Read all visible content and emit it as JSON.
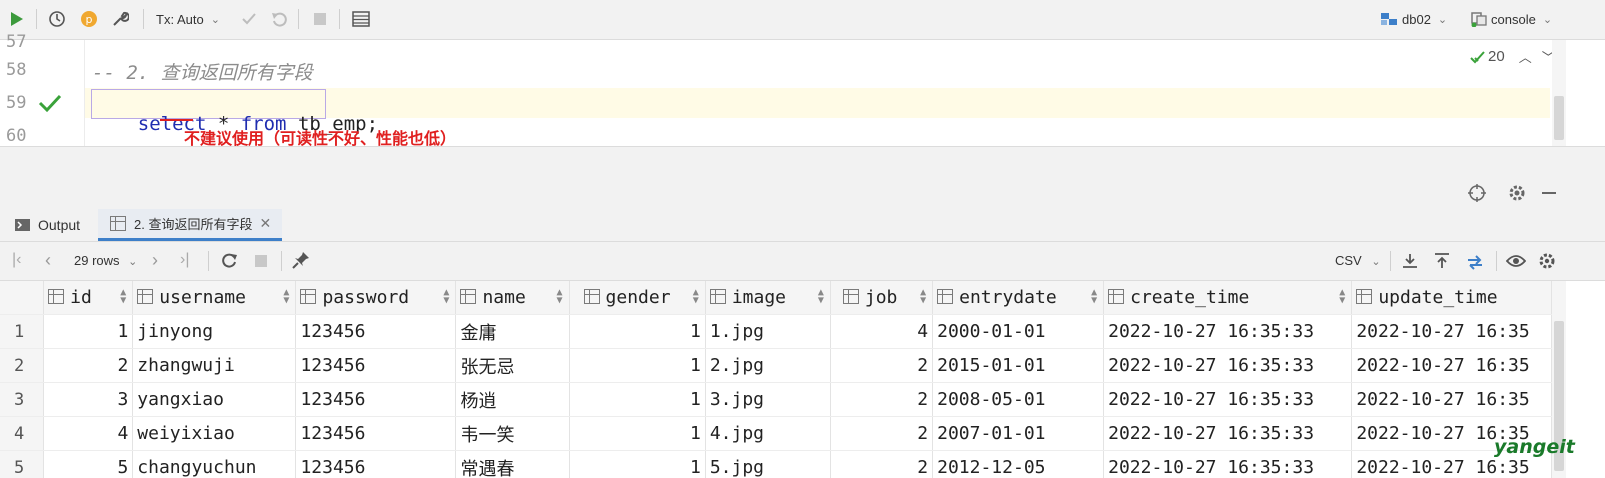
{
  "toolbar": {
    "tx_mode": "Tx: Auto",
    "datasource": "db02",
    "session": "console"
  },
  "editor": {
    "lines": [
      {
        "num": "57",
        "text": ""
      },
      {
        "num": "58",
        "text": "-- 2. 查询返回所有字段"
      },
      {
        "num": "59",
        "text": "select * from tb_emp;"
      },
      {
        "num": "60",
        "text": ""
      }
    ],
    "code_tokens": {
      "kw_select": "select",
      "star": " * ",
      "kw_from": "from",
      "rest": " tb_emp",
      "semi": ";"
    },
    "comment": "-- 2. 查询返回所有字段",
    "annotation": "不建议使用（可读性不好、性能也低）",
    "inspection_count": "20",
    "colors": {
      "keyword": "#1f2db0",
      "comment": "#8c8c8c",
      "annotation": "#e02020",
      "ok_green": "#3aa23a"
    }
  },
  "tabs": [
    {
      "label": "Output",
      "active": false
    },
    {
      "label": "2. 查询返回所有字段",
      "active": true
    }
  ],
  "result_toolbar": {
    "rows_label": "29 rows",
    "export_format": "CSV"
  },
  "grid": {
    "columns": [
      "id",
      "username",
      "password",
      "name",
      "gender",
      "image",
      "job",
      "entrydate",
      "create_time",
      "update_time"
    ],
    "rows": [
      {
        "rn": "1",
        "cells": [
          "1",
          "jinyong",
          "123456",
          "金庸",
          "1",
          "1.jpg",
          "4",
          "2000-01-01",
          "2022-10-27 16:35:33",
          "2022-10-27 16:35"
        ]
      },
      {
        "rn": "2",
        "cells": [
          "2",
          "zhangwuji",
          "123456",
          "张无忌",
          "1",
          "2.jpg",
          "2",
          "2015-01-01",
          "2022-10-27 16:35:33",
          "2022-10-27 16:35"
        ]
      },
      {
        "rn": "3",
        "cells": [
          "3",
          "yangxiao",
          "123456",
          "杨逍",
          "1",
          "3.jpg",
          "2",
          "2008-05-01",
          "2022-10-27 16:35:33",
          "2022-10-27 16:35"
        ]
      },
      {
        "rn": "4",
        "cells": [
          "4",
          "weiyixiao",
          "123456",
          "韦一笑",
          "1",
          "4.jpg",
          "2",
          "2007-01-01",
          "2022-10-27 16:35:33",
          "2022-10-27 16:35"
        ]
      },
      {
        "rn": "5",
        "cells": [
          "5",
          "changyuchun",
          "123456",
          "常遇春",
          "1",
          "5.jpg",
          "2",
          "2012-12-05",
          "2022-10-27 16:35:33",
          "2022-10-27 16:35"
        ]
      }
    ]
  },
  "watermark": "yangeit"
}
